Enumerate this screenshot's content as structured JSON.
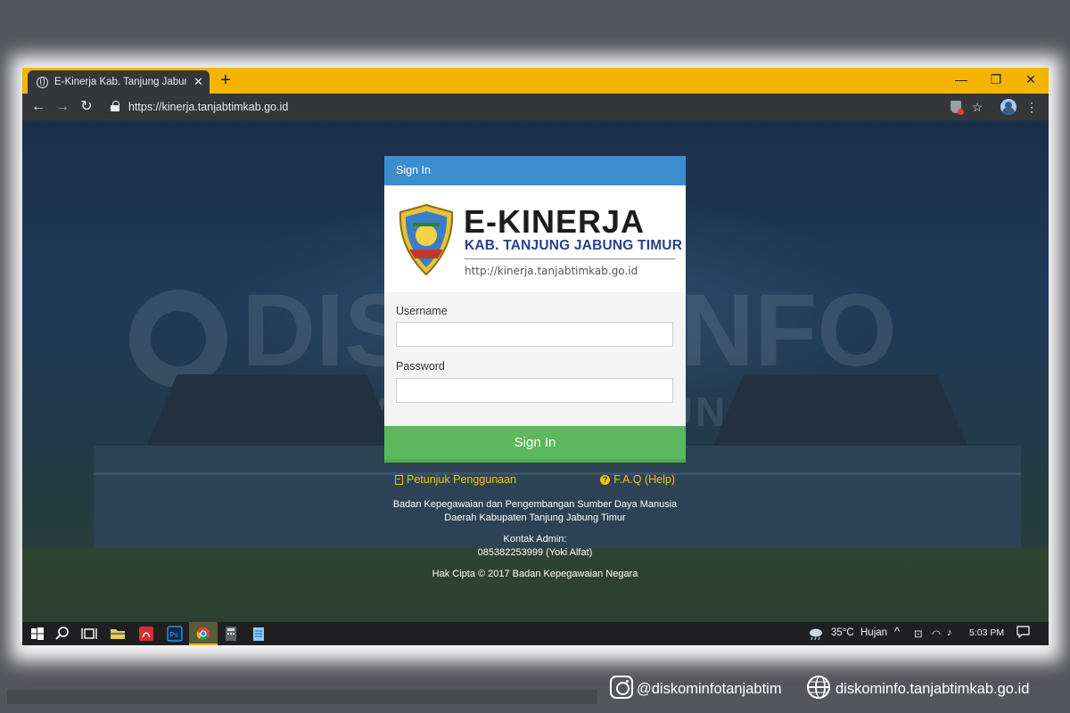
{
  "browser": {
    "tab_title": "E-Kinerja Kab. Tanjung Jabung Timur",
    "tab_close": "✕",
    "new_tab": "+",
    "url": "https://kinerja.tanjabtimkab.go.id",
    "controls": {
      "minimize": "—",
      "restore": "❐",
      "close": "✕"
    },
    "nav": {
      "back": "←",
      "forward": "→",
      "reload": "↻"
    },
    "star": "☆",
    "menu": "⋮"
  },
  "page": {
    "watermark_line1": "DISKOMINFO",
    "watermark_line2": "TANJUNG JABUNG",
    "card_header": "Sign In",
    "brand_title": "E-KINERJA",
    "brand_subtitle": "KAB. TANJUNG JABUNG TIMUR",
    "brand_url": "http://kinerja.tanjabtimkab.go.id",
    "username_label": "Username",
    "username_value": "",
    "password_label": "Password",
    "password_value": "",
    "signin_button": "Sign In",
    "link_guide": "Petunjuk Penggunaan",
    "link_faq": "F.A.Q (Help)",
    "org_line1": "Badan Kepegawaian dan Pengembangan Sumber Daya Manusia",
    "org_line2": "Daerah Kabupaten Tanjung Jabung Timur",
    "contact_label": "Kontak Admin:",
    "contact_value": "085382253999 (Yoki Alfat)",
    "copyright": "Hak Cipta © 2017 Badan Kepegawaian Negara"
  },
  "taskbar": {
    "weather_temp": "35°C",
    "weather_text": "Hujan",
    "time": "5:03 PM",
    "icons": [
      "windows-start-icon",
      "search-icon",
      "task-view-icon",
      "file-explorer-icon",
      "acrobat-icon",
      "photoshop-icon",
      "chrome-icon",
      "calculator-icon",
      "notepad-icon"
    ]
  },
  "footer": {
    "instagram": "@diskominfotanjabtim",
    "website": "diskominfo.tanjabtimkab.go.id"
  },
  "colors": {
    "tab_bar": "#f4b400",
    "card_header": "#3c8dcd",
    "signin_button": "#5cb85c",
    "link": "#f1c40f"
  }
}
